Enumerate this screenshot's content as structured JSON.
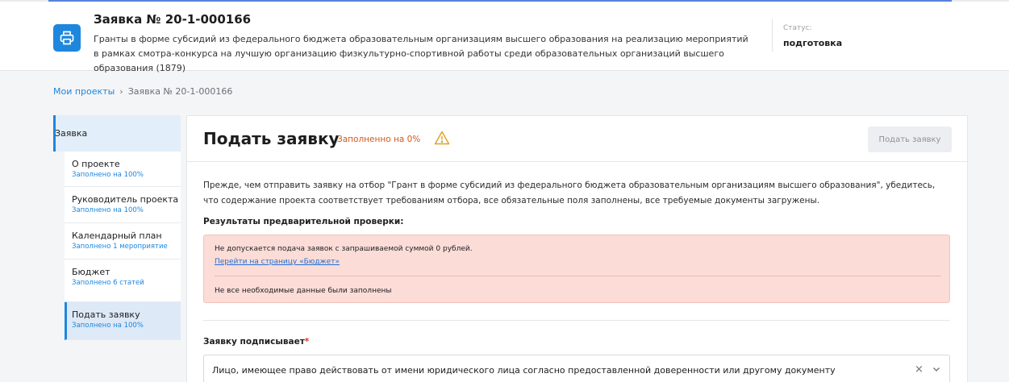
{
  "header": {
    "title": "Заявка № 20-1-000166",
    "description": "Гранты в форме субсидий из федерального бюджета образовательным организациям высшего образования на реализацию мероприятий в рамках смотра-конкурса на лучшую организацию физкультурно-спортивной работы среди образовательных организаций высшего образования (1879)",
    "status_label": "Статус:",
    "status_value": "подготовка",
    "icon": "printer-icon"
  },
  "breadcrumb": {
    "root": "Мои проекты",
    "separator": "›",
    "current": "Заявка № 20-1-000166"
  },
  "sidebar": {
    "header": "Заявка",
    "items": [
      {
        "label": "О проекте",
        "sub": "Заполнено на 100%"
      },
      {
        "label": "Руководитель проекта",
        "sub": "Заполнено на 100%"
      },
      {
        "label": "Календарный план",
        "sub": "Заполнено 1 мероприятие"
      },
      {
        "label": "Бюджет",
        "sub": "Заполнено 6 статей"
      },
      {
        "label": "Подать заявку",
        "sub": "Заполнено на 100%"
      }
    ]
  },
  "main": {
    "title": "Подать заявку",
    "fill_status": "Заполненно на 0%",
    "submit_button": "Подать заявку",
    "intro": "Прежде, чем отправить заявку на отбор \"Грант в форме субсидий из федерального бюджета образовательным организациям высшего образования\", убедитесь, что содержание проекта соответствует требованиям отбора, все обязательные поля заполнены, все требуемые документы загружены.",
    "results_title": "Результаты предварительной проверки:",
    "alert": {
      "message1": "Не допускается подача заявок с запрашиваемой суммой 0 рублей.",
      "link": "Перейти на страницу «Бюджет»",
      "message2": "Не все необходимые данные были заполнены"
    },
    "signer_label": "Заявку подписывает",
    "signer_required_mark": "*",
    "signer_value": "Лицо, имеющее право действовать от имени юридического лица согласно предоставленной доверенности или другому документу",
    "clear_glyph": "×"
  },
  "colors": {
    "accent": "#1d87dd",
    "warning": "#d2571e",
    "alert_bg": "#fbdcd7"
  }
}
